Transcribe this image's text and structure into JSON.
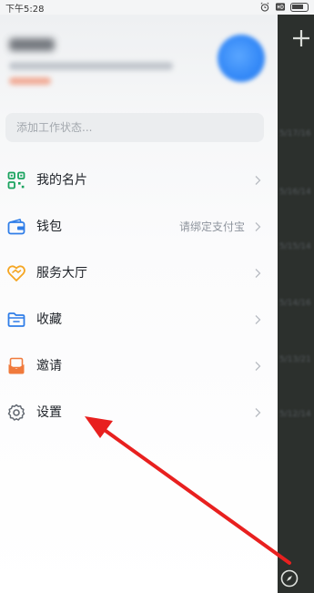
{
  "status_bar": {
    "time": "下午5:28",
    "icons": [
      "alarm-icon",
      "hd-icon",
      "battery-icon"
    ]
  },
  "profile": {
    "status_placeholder": "添加工作状态..."
  },
  "menu": [
    {
      "id": "my-card",
      "label": "我的名片",
      "hint": "",
      "icon": "qr-card-icon",
      "color": "#1aa35f"
    },
    {
      "id": "wallet",
      "label": "钱包",
      "hint": "请绑定支付宝",
      "icon": "wallet-icon",
      "color": "#2f7de8"
    },
    {
      "id": "service-hall",
      "label": "服务大厅",
      "hint": "",
      "icon": "service-heart-icon",
      "color": "#f5a623"
    },
    {
      "id": "favorites",
      "label": "收藏",
      "hint": "",
      "icon": "folder-icon",
      "color": "#2f7de8"
    },
    {
      "id": "invite",
      "label": "邀请",
      "hint": "",
      "icon": "invite-icon",
      "color": "#f07a3c"
    },
    {
      "id": "settings",
      "label": "设置",
      "hint": "",
      "icon": "gear-icon",
      "color": "#646a73"
    }
  ],
  "background_list": {
    "dates": [
      "5/17/16",
      "5/16/14",
      "5/15/14",
      "5/14/16",
      "5/13/21",
      "5/12/14"
    ]
  },
  "colors": {
    "annotation": "#e8201f",
    "accent": "#2f7de8"
  }
}
